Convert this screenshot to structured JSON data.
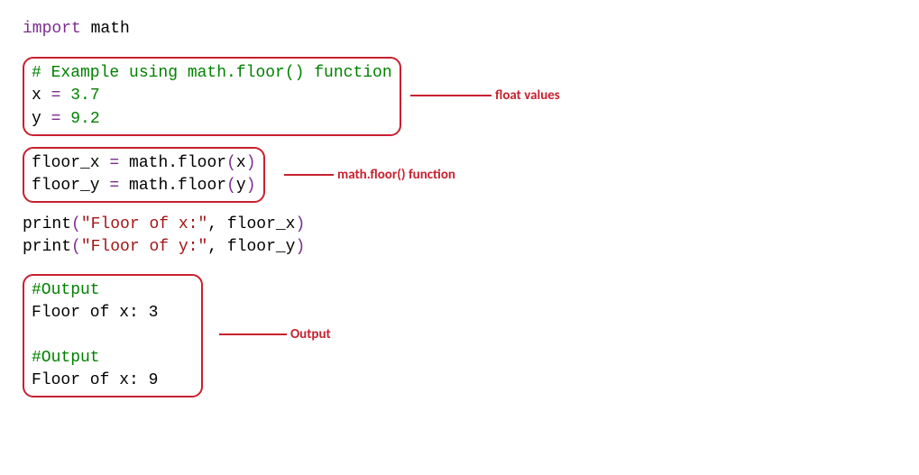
{
  "code": {
    "import_keyword": "import",
    "module_name": " math",
    "comment_example": "# Example using math.floor() function",
    "assign_x_var": "x ",
    "assign_x_op": "=",
    "assign_x_val": " 3.7",
    "assign_y_var": "y ",
    "assign_y_op": "=",
    "assign_y_val": " 9.2",
    "floor_x_var": "floor_x ",
    "floor_x_op": "=",
    "floor_x_call_pre": " math.floor",
    "floor_x_paren_open": "(",
    "floor_x_arg": "x",
    "floor_x_paren_close": ")",
    "floor_y_var": "floor_y ",
    "floor_y_op": "=",
    "floor_y_call_pre": " math.floor",
    "floor_y_paren_open": "(",
    "floor_y_arg": "y",
    "floor_y_paren_close": ")",
    "print1_func": "print",
    "print1_paren_open": "(",
    "print1_str": "\"Floor of x:\"",
    "print1_comma": ", floor_x",
    "print1_paren_close": ")",
    "print2_func": "print",
    "print2_paren_open": "(",
    "print2_str": "\"Floor of y:\"",
    "print2_comma": ", floor_y",
    "print2_paren_close": ")",
    "output_comment1": "#Output",
    "output_line1": "Floor of x: 3",
    "output_comment2": "#Output",
    "output_line2": "Floor of x: 9"
  },
  "annotations": {
    "float_values": "float values",
    "math_floor_function": "math.floor() function",
    "output": "Output"
  }
}
